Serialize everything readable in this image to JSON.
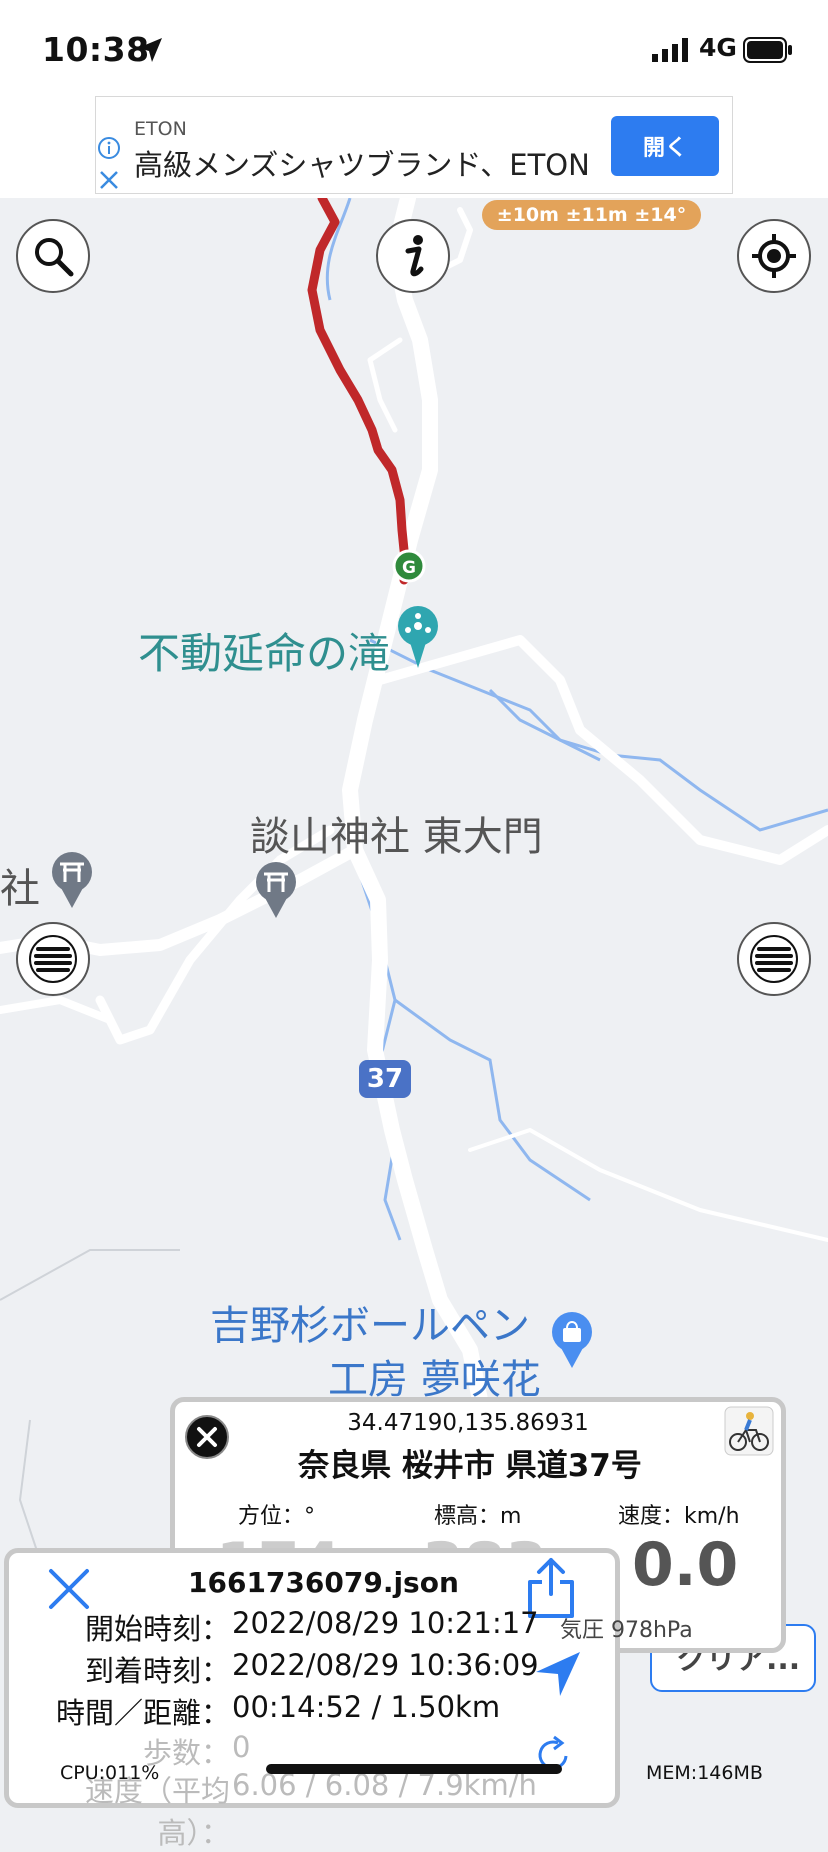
{
  "status_bar": {
    "time": "10:38",
    "network": "4G"
  },
  "ad": {
    "brand": "ETON",
    "text": "高級メンズシャツブランド、ETON",
    "open_label": "開く"
  },
  "map": {
    "accuracy": "±10m ±11m ±14°",
    "labels": {
      "waterfall": "不動延命の滝",
      "shrine_gate": "談山神社 東大門",
      "shrine_partial": "社",
      "pen_shop_line1": "吉野杉ボールペン",
      "pen_shop_line2": "工房 夢咲花",
      "route_number": "37"
    },
    "goal_marker": "G",
    "colors": {
      "track": "#c0282a",
      "water": "#8fb7ef",
      "road": "#ffffff",
      "background": "#eef0f3"
    }
  },
  "info_panel": {
    "coords": "34.47190,135.86931",
    "address": "奈良県 桜井市 県道37号",
    "headers": {
      "direction": "方位：°",
      "elevation": "標高：m",
      "speed": "速度：km/h"
    },
    "values": {
      "direction": "174",
      "elevation": "383",
      "speed": "0.0"
    },
    "pressure": "気圧 978hPa"
  },
  "clear_button": {
    "label": "クリア..."
  },
  "track_panel": {
    "filename": "1661736079.json",
    "rows": [
      {
        "label": "開始時刻：",
        "value": "2022/08/29 10:21:17"
      },
      {
        "label": "到着時刻：",
        "value": "2022/08/29 10:36:09"
      },
      {
        "label": "時間／距離：",
        "value": "00:14:52 / 1.50km"
      },
      {
        "label": "歩数：",
        "value": "0"
      },
      {
        "label": "速度（平均高）：",
        "value": "6.06 / 6.08 / 7.9km/h"
      }
    ]
  },
  "footer": {
    "cpu": "CPU:011%",
    "mem": "MEM:146MB"
  },
  "icons": [
    "location-arrow-icon",
    "signal-icon",
    "battery-icon",
    "info-icon",
    "close-icon",
    "search-icon",
    "info-i-icon",
    "locate-icon",
    "menu-icon",
    "close-circle-icon",
    "bicycle-icon",
    "share-icon",
    "navigation-arrow-icon",
    "refresh-icon",
    "shrine-icon",
    "waterfall-pin-icon",
    "shop-pin-icon",
    "goal-marker-icon"
  ]
}
